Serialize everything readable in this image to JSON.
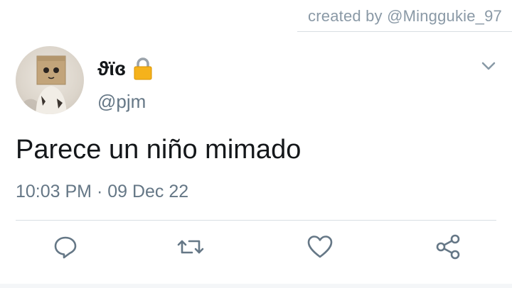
{
  "credit": {
    "text": "created by @Minggukie_97"
  },
  "tweet": {
    "display_name": "ϑϊɞ",
    "handle": "@pjm",
    "text": "Parece un niño mimado",
    "timestamp": "10:03 PM · 09 Dec 22",
    "protected": true
  },
  "icons": {
    "lock": "lock-icon",
    "more": "chevron-down-icon",
    "reply": "reply-icon",
    "retweet": "retweet-icon",
    "like": "heart-icon",
    "share": "share-icon"
  },
  "colors": {
    "text": "#14171a",
    "secondary": "#657786",
    "icon": "#657786",
    "credit": "#8a99a6",
    "divider": "#d8dee3"
  }
}
